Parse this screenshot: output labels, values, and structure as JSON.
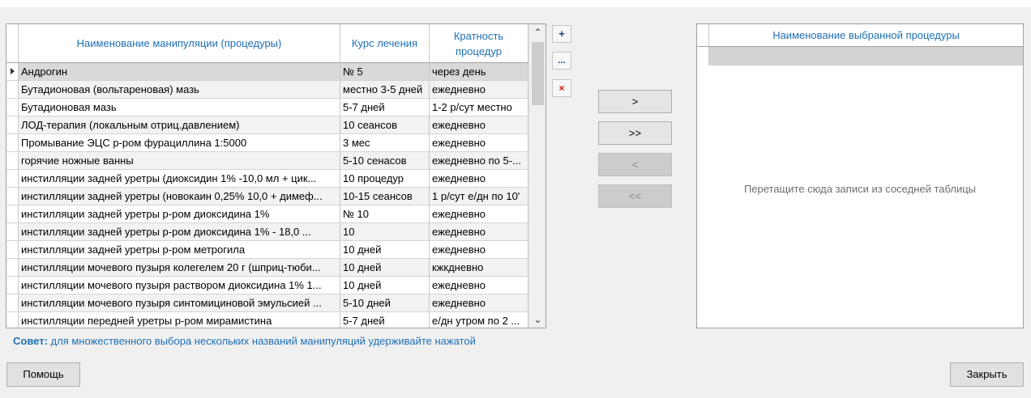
{
  "left_table": {
    "headers": [
      "Наименование манипуляции (процедуры)",
      "Курс лечения",
      "Кратность процедур"
    ],
    "rows": [
      [
        "Андрогин",
        "№ 5",
        "через день"
      ],
      [
        "Бутадионовая (вольтареновая) мазь",
        "местно 3-5 дней",
        "ежедневно"
      ],
      [
        "Бутадионовая мазь",
        "5-7 дней",
        "1-2 р/сут местно"
      ],
      [
        "ЛОД-терапия (локальным отриц.давлением)",
        "10 сеансов",
        "ежедневно"
      ],
      [
        "Промывание ЭЦС р-ром фурациллина 1:5000",
        "3 мес",
        "ежедневно"
      ],
      [
        "горячие ножные ванны",
        "5-10 сенасов",
        "ежедневно по 5-..."
      ],
      [
        "инстилляции задней уретры (диоксидин 1% -10,0 мл + цик...",
        "10 процедур",
        "ежедневно"
      ],
      [
        "инстилляции задней уретры (новокаин 0,25% 10,0 + димеф...",
        "10-15 сеансов",
        "1 р/сут е/дн по 10'"
      ],
      [
        "инстилляции задней уретры р-ром диоксидина 1%",
        "№ 10",
        "ежедневно"
      ],
      [
        "инстилляции задней уретры р-ром диоксидина 1%  - 18,0 ...",
        "10",
        "ежедневно"
      ],
      [
        "инстилляции задней уретры р-ром метрогила",
        "10 дней",
        "ежедневно"
      ],
      [
        "инстилляции мочевого пузыря колегелем 20 г (шприц-тюби...",
        "10 дней",
        "кжкдневно"
      ],
      [
        "инстилляции мочевого пузыря раствором диоксидина 1% 1...",
        "10 дней",
        "ежедневно"
      ],
      [
        "инстилляции мочевого пузыря синтомициновой эмульсией ...",
        "5-10 дней",
        "ежедневно"
      ],
      [
        "инстилляции передней уретры р-ром мирамистина",
        "5-7 дней",
        "е/дн утром по 2 ..."
      ]
    ]
  },
  "side_buttons": {
    "add": "+",
    "more": "...",
    "delete": "×"
  },
  "transfer_buttons": {
    "move_right": ">",
    "move_all_right": ">>",
    "move_left": "<",
    "move_all_left": "<<"
  },
  "right_table": {
    "header": "Наименование выбранной процедуры",
    "empty_message": "Перетащите сюда записи из соседней таблицы"
  },
  "tip": {
    "label": "Совет:",
    "text": "для множественного выбора нескольких названий манипуляций удерживайте нажатой"
  },
  "buttons": {
    "help": "Помощь",
    "close": "Закрыть"
  },
  "colors": {
    "header_text": "#1f6fb5",
    "selected_row": "#d9d9d9",
    "delete_icon": "#dd1111"
  }
}
